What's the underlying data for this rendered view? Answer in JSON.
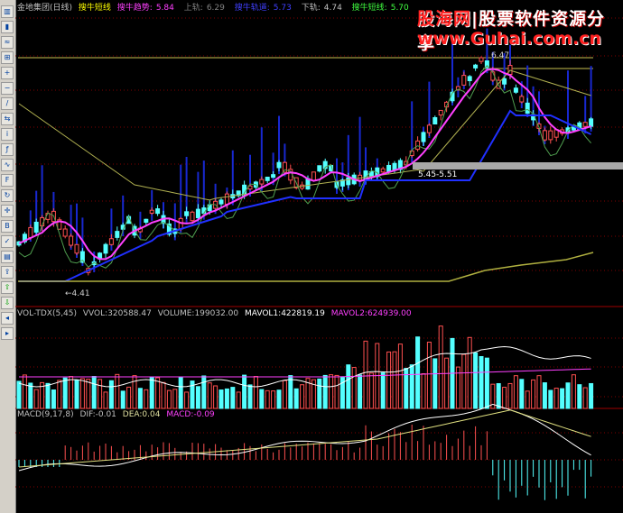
{
  "toolbar": {
    "icons": [
      "chart-type-icon",
      "kline-icon",
      "indicator-icon",
      "period-icon",
      "zoom-in-icon",
      "zoom-out-icon",
      "draw-line-icon",
      "compare-icon",
      "info-icon",
      "formula-icon",
      "fenshi-icon",
      "f10-icon",
      "refresh-icon",
      "cross-icon",
      "bsp-icon",
      "tick-icon",
      "layout-icon",
      "export-icon",
      "up-arrow-icon",
      "down-arrow-icon",
      "scroll-left-icon",
      "scroll-right-icon"
    ]
  },
  "header": {
    "stock": "金地集团(日线)",
    "indicator": "搜牛短线",
    "trend_label": "搜牛趋势:",
    "trend_value": "5.84",
    "upper_label": "上轨:",
    "upper_value": "6.29",
    "track_label": "搜牛轨道:",
    "track_value": "5.73",
    "lower_label": "下轨:",
    "lower_value": "4.74",
    "short_label": "搜牛短线:",
    "short_value": "5.70"
  },
  "watermark": {
    "part1": "股海网",
    "part2": "股票软件资源分享",
    "url": "www.Guhai.com.cn"
  },
  "price_annotations": {
    "high": "6.47",
    "low": "4.41",
    "box": "5.45-5.51"
  },
  "volume_header": {
    "name": "VOL-TDX(5,45)",
    "vvol": "VVOL:320588.47",
    "volume": "VOLUME:199032.00",
    "mavol1": "MAVOL1:422819.19",
    "mavol2": "MAVOL2:624939.00"
  },
  "macd_header": {
    "name": "MACD(9,17,8)",
    "dif": "DIF:-0.01",
    "dea": "DEA:0.04",
    "macd": "MACD:-0.09"
  },
  "colors": {
    "up": "#ff5050",
    "down": "#54ffff",
    "track": "#2030ff",
    "short": "#ff40ff",
    "trend": "#b0b050",
    "grid": "#800000"
  }
}
